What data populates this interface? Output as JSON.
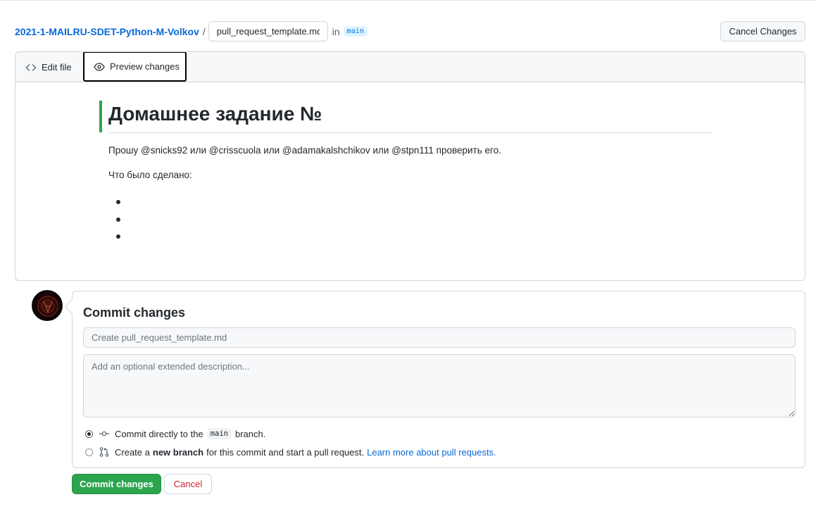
{
  "breadcrumb": {
    "repo": "2021-1-MAILRU-SDET-Python-M-Volkov",
    "separator": "/",
    "filename": "pull_request_template.md",
    "in_label": "in",
    "branch": "main"
  },
  "header": {
    "cancel_label": "Cancel Changes"
  },
  "tabs": {
    "edit_label": "Edit file",
    "preview_label": "Preview changes",
    "active": "preview"
  },
  "preview": {
    "heading": "Домашнее задание №",
    "paragraph1": "Прошу @snicks92 или @crisscuola или @adamakalshchikov или @stpn111 проверить его.",
    "paragraph2": "Что было сделано:",
    "bullet_count": 3
  },
  "commit": {
    "title": "Commit changes",
    "summary_placeholder": "Create pull_request_template.md",
    "description_placeholder": "Add an optional extended description...",
    "option_direct_prefix": "Commit directly to the",
    "option_direct_branch": "main",
    "option_direct_suffix": "branch.",
    "option_new_prefix": "Create a",
    "option_new_bold": "new branch",
    "option_new_suffix": "for this commit and start a pull request.",
    "learn_more": "Learn more about pull requests.",
    "selected_option": "direct",
    "commit_button": "Commit changes",
    "cancel_button": "Cancel"
  },
  "colors": {
    "link": "#0969da",
    "primary_button": "#2da44e",
    "danger_text": "#cf222e",
    "heading_bar": "#2da44e"
  }
}
